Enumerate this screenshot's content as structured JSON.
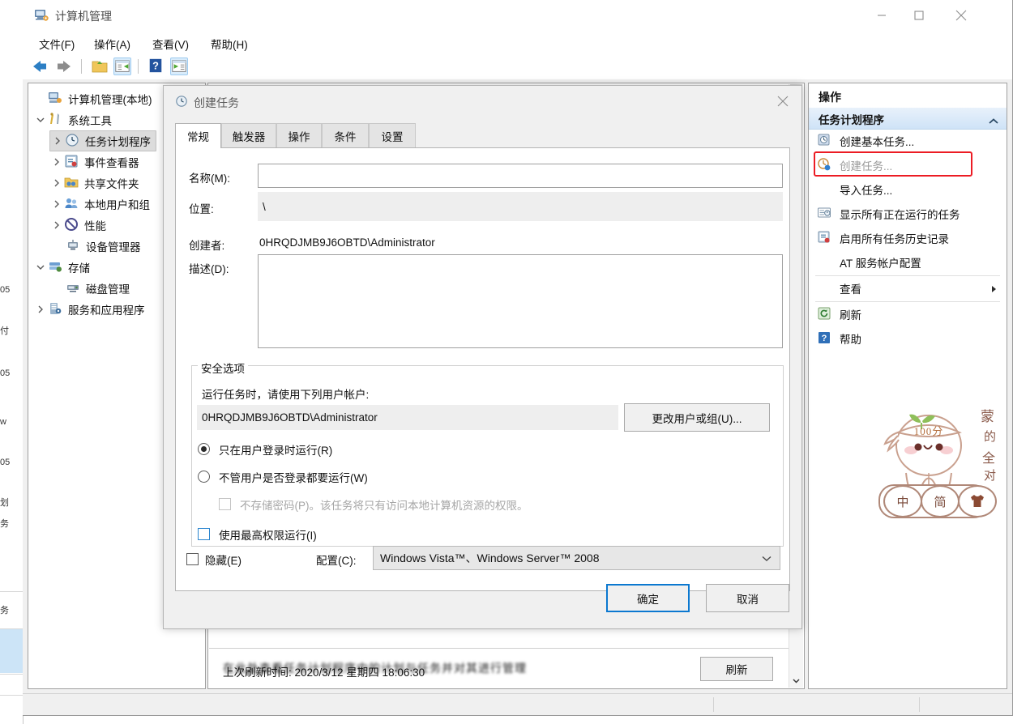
{
  "window": {
    "title": "计算机管理",
    "icon": "computer-management-icon",
    "controls": {
      "minimize": "最小化",
      "maximize": "最大化",
      "close": "关闭"
    }
  },
  "menubar": {
    "items": [
      {
        "label": "文件(F)",
        "name": "menu-file"
      },
      {
        "label": "操作(A)",
        "name": "menu-action"
      },
      {
        "label": "查看(V)",
        "name": "menu-view"
      },
      {
        "label": "帮助(H)",
        "name": "menu-help"
      }
    ]
  },
  "toolbar": {
    "items": [
      {
        "name": "back-icon",
        "title": "后退"
      },
      {
        "name": "forward-icon",
        "title": "前进"
      },
      {
        "name": "up-folder-icon",
        "title": "上移一级"
      },
      {
        "name": "show-hide-tree-icon",
        "title": "显示/隐藏控制台树"
      },
      {
        "name": "help-icon",
        "title": "帮助"
      },
      {
        "name": "show-action-pane-icon",
        "title": "显示/隐藏操作窗格"
      }
    ]
  },
  "tree": {
    "nodes": [
      {
        "label": "计算机管理(本地)",
        "indent": 0,
        "twisty": "none",
        "icon": "computer-icon",
        "selected": false
      },
      {
        "label": "系统工具",
        "indent": 1,
        "twisty": "expanded",
        "icon": "system-tools-icon",
        "selected": false
      },
      {
        "label": "任务计划程序",
        "indent": 2,
        "twisty": "collapsed",
        "icon": "task-scheduler-icon",
        "selected": true
      },
      {
        "label": "事件查看器",
        "indent": 2,
        "twisty": "collapsed",
        "icon": "event-viewer-icon",
        "selected": false
      },
      {
        "label": "共享文件夹",
        "indent": 2,
        "twisty": "collapsed",
        "icon": "shared-folders-icon",
        "selected": false
      },
      {
        "label": "本地用户和组",
        "indent": 2,
        "twisty": "collapsed",
        "icon": "local-users-icon",
        "selected": false
      },
      {
        "label": "性能",
        "indent": 2,
        "twisty": "collapsed",
        "icon": "performance-icon",
        "selected": false
      },
      {
        "label": "设备管理器",
        "indent": 2,
        "twisty": "none",
        "icon": "device-manager-icon",
        "selected": false
      },
      {
        "label": "存储",
        "indent": 1,
        "twisty": "expanded",
        "icon": "storage-icon",
        "selected": false
      },
      {
        "label": "磁盘管理",
        "indent": 2,
        "twisty": "none",
        "icon": "disk-management-icon",
        "selected": false
      },
      {
        "label": "服务和应用程序",
        "indent": 1,
        "twisty": "collapsed",
        "icon": "services-apps-icon",
        "selected": false
      }
    ]
  },
  "middle": {
    "blurred_text": "在此处查看任务计划程序中的计划与任务并对其进行管理",
    "refresh_status": "上次刷新时间: 2020/3/12 星期四 18:06:30",
    "refresh_button": "刷新"
  },
  "actions": {
    "header": "操作",
    "group_label": "任务计划程序",
    "items": [
      {
        "label": "创建基本任务...",
        "icon": "create-basic-task-icon",
        "highlight": false,
        "dim": false,
        "submenu": false
      },
      {
        "label": "创建任务...",
        "icon": "create-task-icon",
        "highlight": true,
        "dim": true,
        "submenu": false
      },
      {
        "label": "导入任务...",
        "icon": "",
        "highlight": false,
        "dim": false,
        "submenu": false
      },
      {
        "label": "显示所有正在运行的任务",
        "icon": "running-tasks-icon",
        "highlight": false,
        "dim": false,
        "submenu": false
      },
      {
        "label": "启用所有任务历史记录",
        "icon": "task-history-icon",
        "highlight": false,
        "dim": false,
        "submenu": false
      },
      {
        "label": "AT 服务帐户配置",
        "icon": "",
        "highlight": false,
        "dim": false,
        "submenu": false
      },
      {
        "label": "查看",
        "icon": "",
        "highlight": false,
        "dim": false,
        "submenu": true
      },
      {
        "label": "刷新",
        "icon": "refresh-icon",
        "highlight": false,
        "dim": false,
        "submenu": false
      },
      {
        "label": "帮助",
        "icon": "help-blue-icon",
        "highlight": false,
        "dim": false,
        "submenu": false
      }
    ],
    "highlight_color": "#ec1c24"
  },
  "dialog": {
    "title": "创建任务",
    "icon": "task-scheduler-icon",
    "close_label": "关闭",
    "tabs": [
      {
        "label": "常规",
        "active": true
      },
      {
        "label": "触发器",
        "active": false
      },
      {
        "label": "操作",
        "active": false
      },
      {
        "label": "条件",
        "active": false
      },
      {
        "label": "设置",
        "active": false
      }
    ],
    "fields": {
      "name_label": "名称(M):",
      "name_value": "",
      "name_placeholder": "",
      "location_label": "位置:",
      "location_value": "\\",
      "author_label": "创建者:",
      "author_value": "0HRQDJMB9J6OBTD\\Administrator",
      "description_label": "描述(D):",
      "description_value": "",
      "description_placeholder": ""
    },
    "security": {
      "group_title": "安全选项",
      "prompt": "运行任务时，请使用下列用户帐户:",
      "account_value": "0HRQDJMB9J6OBTD\\Administrator",
      "change_user_button": "更改用户或组(U)...",
      "radio_logged_on": "只在用户登录时运行(R)",
      "radio_any": "不管用户是否登录都要运行(W)",
      "checkbox_no_password": "不存储密码(P)。该任务将只有访问本地计算机资源的权限。",
      "checkbox_highest": "使用最高权限运行(I)",
      "selected_radio": "radio_logged_on",
      "no_password_checked": false,
      "highest_checked": false
    },
    "footer": {
      "hidden_checkbox": "隐藏(E)",
      "hidden_checked": false,
      "configure_label": "配置(C):",
      "configure_value": "Windows Vista™、Windows Server™ 2008",
      "ok_button": "确定",
      "cancel_button": "取消"
    }
  },
  "ime": {
    "headband_text": "100分",
    "face_text": "owo",
    "side_text": [
      "蒙",
      "的",
      "全",
      "对"
    ],
    "keys": [
      {
        "label": "中",
        "name": "ime-chinese-english-toggle"
      },
      {
        "label": "简",
        "name": "ime-simplified-traditional-toggle"
      },
      {
        "label": "skin",
        "name": "ime-skin-button"
      }
    ]
  },
  "background_window": {
    "fragments": [
      "05",
      "付",
      "05",
      "w",
      "05",
      "划",
      "务",
      "务"
    ]
  }
}
